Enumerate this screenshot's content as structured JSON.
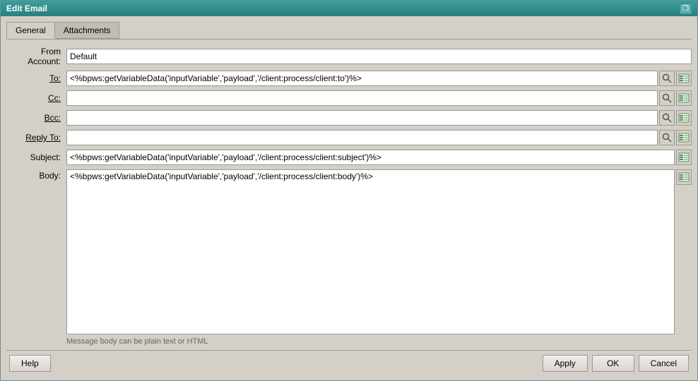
{
  "window": {
    "title": "Edit Email",
    "restore_icon": "❐"
  },
  "tabs": [
    {
      "id": "general",
      "label": "General",
      "active": true
    },
    {
      "id": "attachments",
      "label": "Attachments",
      "active": false
    }
  ],
  "form": {
    "from_account_label": "From Account:",
    "from_account_value": "Default",
    "to_label": "To:",
    "to_value": "<%bpws:getVariableData('inputVariable','payload','/client:process/client:to')%>",
    "cc_label": "Cc:",
    "cc_value": "",
    "bcc_label": "Bcc:",
    "bcc_value": "",
    "reply_to_label": "Reply To:",
    "reply_to_value": "",
    "subject_label": "Subject:",
    "subject_value": "<%bpws:getVariableData('inputVariable','payload','/client:process/client:subject')%>",
    "body_label": "Body:",
    "body_value": "<%bpws:getVariableData('inputVariable','payload','/client:process/client:body')%>",
    "body_hint": "Message body can be plain text or HTML"
  },
  "buttons": {
    "help_label": "Help",
    "apply_label": "Apply",
    "ok_label": "OK",
    "cancel_label": "Cancel"
  }
}
